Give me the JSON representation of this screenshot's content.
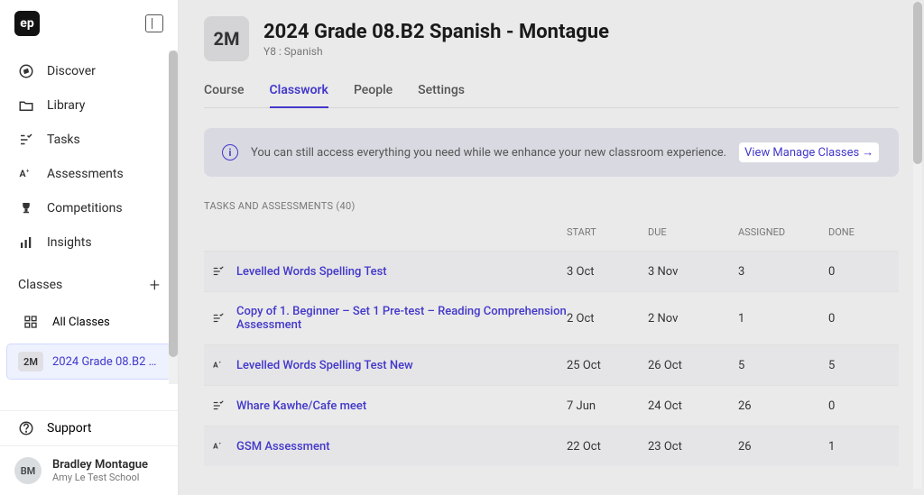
{
  "logo": "ep",
  "nav": {
    "discover": "Discover",
    "library": "Library",
    "tasks": "Tasks",
    "assessments": "Assessments",
    "competitions": "Competitions",
    "insights": "Insights"
  },
  "classes": {
    "header": "Classes",
    "all": "All Classes",
    "selected_badge": "2M",
    "selected_label": "2024 Grade 08.B2 …"
  },
  "support": "Support",
  "user": {
    "initials": "BM",
    "name": "Bradley Montague",
    "sub": "Amy Le Test School"
  },
  "page": {
    "icon_text": "2M",
    "title": "2024 Grade 08.B2 Spanish - Montague",
    "subtitle": "Y8 : Spanish"
  },
  "tabs": {
    "course": "Course",
    "classwork": "Classwork",
    "people": "People",
    "settings": "Settings"
  },
  "banner": {
    "text": "You can still access everything you need while we enhance your new classroom experience.",
    "link": "View Manage Classes"
  },
  "section_title": "TASKS AND ASSESSMENTS (40)",
  "columns": {
    "start": "START",
    "due": "DUE",
    "assigned": "ASSIGNED",
    "done": "DONE"
  },
  "rows": [
    {
      "type": "task",
      "name": "Levelled Words Spelling Test",
      "start": "3 Oct",
      "due": "3 Nov",
      "assigned": "3",
      "done": "0"
    },
    {
      "type": "task",
      "name": "Copy of 1. Beginner – Set 1 Pre-test – Reading Comprehension Assessment",
      "start": "2 Oct",
      "due": "2 Nov",
      "assigned": "1",
      "done": "0"
    },
    {
      "type": "assessment",
      "name": "Levelled Words Spelling Test New",
      "start": "25 Oct",
      "due": "26 Oct",
      "assigned": "5",
      "done": "5"
    },
    {
      "type": "task",
      "name": "Whare Kawhe/Cafe meet",
      "start": "7 Jun",
      "due": "24 Oct",
      "assigned": "26",
      "done": "0"
    },
    {
      "type": "assessment",
      "name": "GSM Assessment",
      "start": "22 Oct",
      "due": "23 Oct",
      "assigned": "26",
      "done": "1"
    }
  ]
}
